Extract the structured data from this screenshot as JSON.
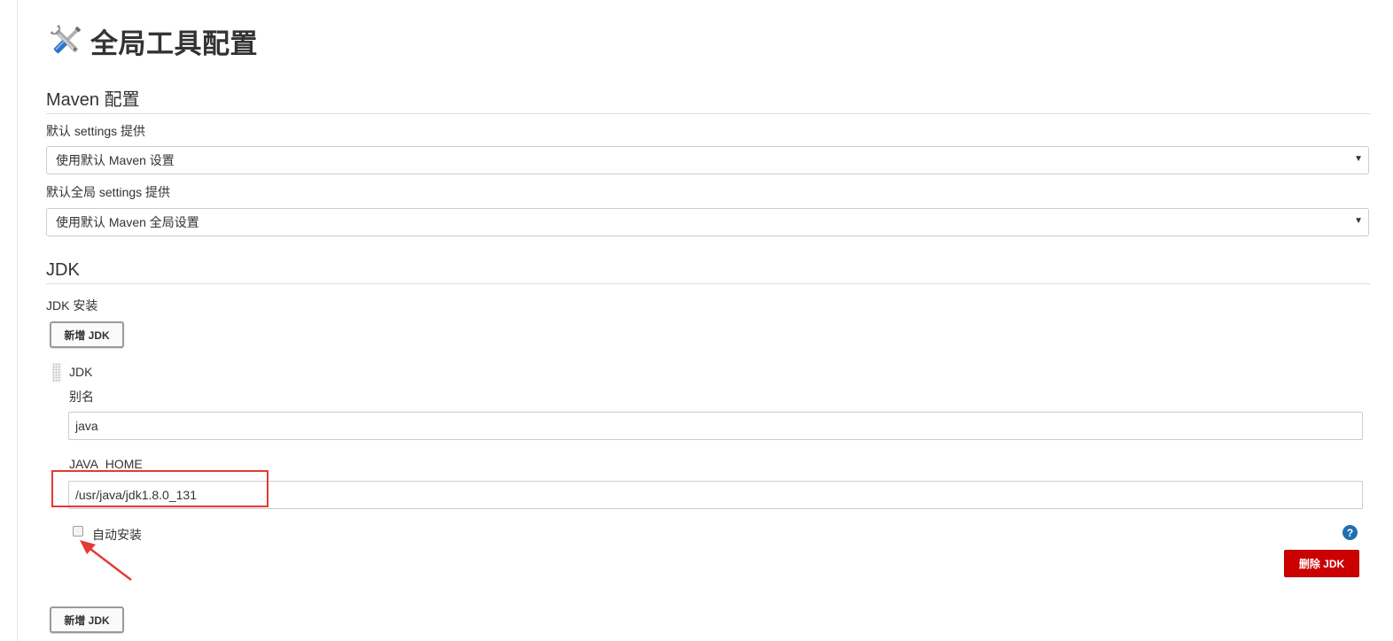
{
  "page": {
    "title": "全局工具配置"
  },
  "maven": {
    "header": "Maven 配置",
    "settings_label": "默认 settings 提供",
    "settings_value": "使用默认 Maven 设置",
    "global_settings_label": "默认全局 settings 提供",
    "global_settings_value": "使用默认 Maven 全局设置"
  },
  "jdk": {
    "header": "JDK",
    "install_label": "JDK 安装",
    "add_button": "新增 JDK",
    "entry": {
      "title": "JDK",
      "alias_label": "别名",
      "alias_value": "java",
      "java_home_label": "JAVA_HOME",
      "java_home_value": "/usr/java/jdk1.8.0_131",
      "auto_install_label": "自动安装",
      "auto_install_checked": false,
      "help_glyph": "?",
      "delete_button": "删除 JDK"
    },
    "add_button_bottom": "新增 JDK"
  },
  "icons": {
    "title_icon": "wrench-screwdriver-icon",
    "help_icon": "help-icon",
    "drag_handle": "drag-handle-icon",
    "caret": "chevron-down-icon"
  },
  "colors": {
    "annotation_red": "#e53935",
    "delete_button": "#cc0000",
    "help_blue": "#1f6fb2"
  }
}
